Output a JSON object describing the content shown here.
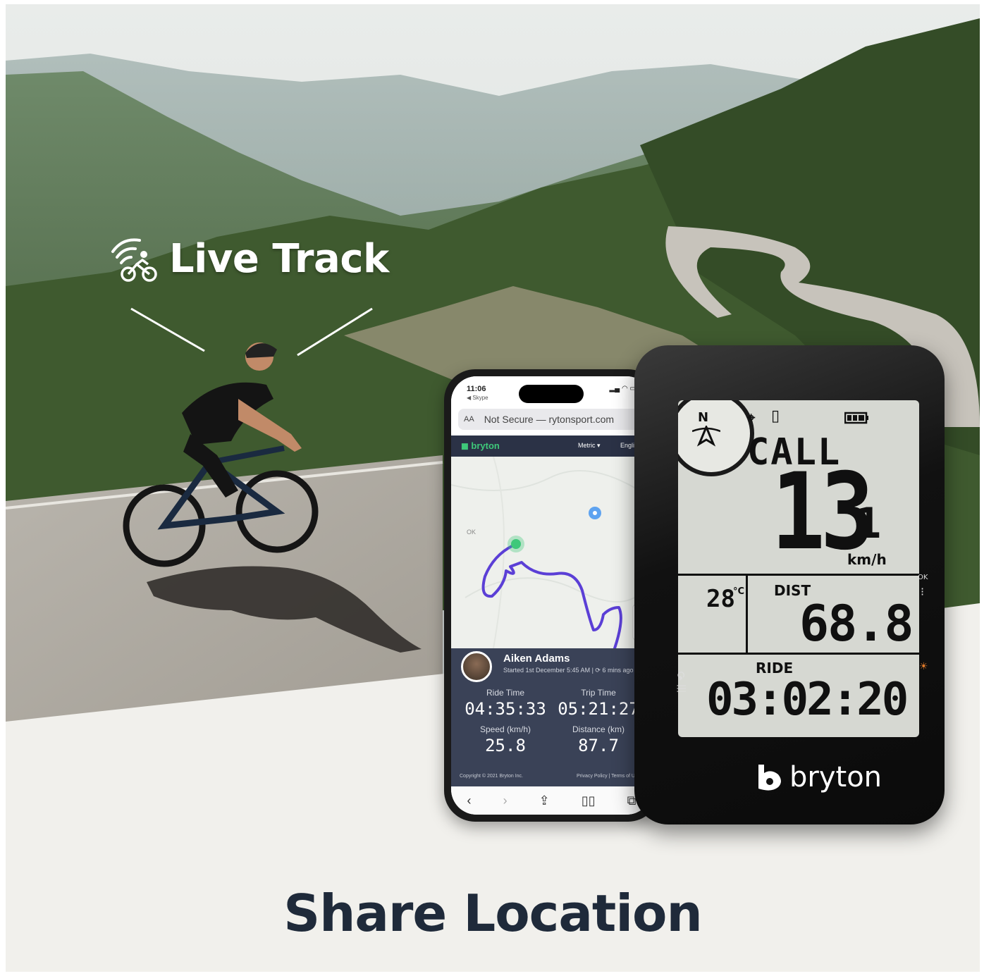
{
  "hero": {
    "live_track_label": "Live Track",
    "live_track_icon": "wifi-cyclist-icon",
    "headline": "Share Location"
  },
  "phone": {
    "status_time": "11:06",
    "status_back": "◀ Skype",
    "url_aa": "AA",
    "url_text": "Not Secure — rytonsport.com",
    "site_brand": "bryton",
    "site_units": "Metric",
    "site_language": "English",
    "map_ok_label": "OK",
    "rider": {
      "name": "Aiken Adams",
      "started": "Started 1st December 5:45 AM",
      "updated": "6 mins ago"
    },
    "stats": [
      {
        "label": "Ride Time",
        "value": "04:35:33"
      },
      {
        "label": "Trip Time",
        "value": "05:21:27"
      },
      {
        "label": "Speed (km/h)",
        "value": "25.8"
      },
      {
        "label": "Distance (km)",
        "value": "87.7"
      }
    ],
    "copyright": "Copyright © 2021 Bryton Inc.",
    "policy": "Privacy Policy | Terms of Use"
  },
  "device": {
    "compass_letter": "N",
    "call_label": "CALL",
    "speed_value": "13",
    "speed_decimal": "1",
    "speed_unit": "km/h",
    "temperature_value": "28",
    "temperature_unit": "°C",
    "dist_label": "DIST",
    "dist_value": "68.8",
    "ride_label": "RIDE",
    "ride_value": "03:02:20",
    "brand": "bryton",
    "key_ok": "OK",
    "key_back": "⟲",
    "key_menu": "|||"
  },
  "colors": {
    "headline": "#1f2a3a",
    "route": "#5b3fd6",
    "panel": "#3a4257",
    "brand_green": "#3ec87a"
  }
}
